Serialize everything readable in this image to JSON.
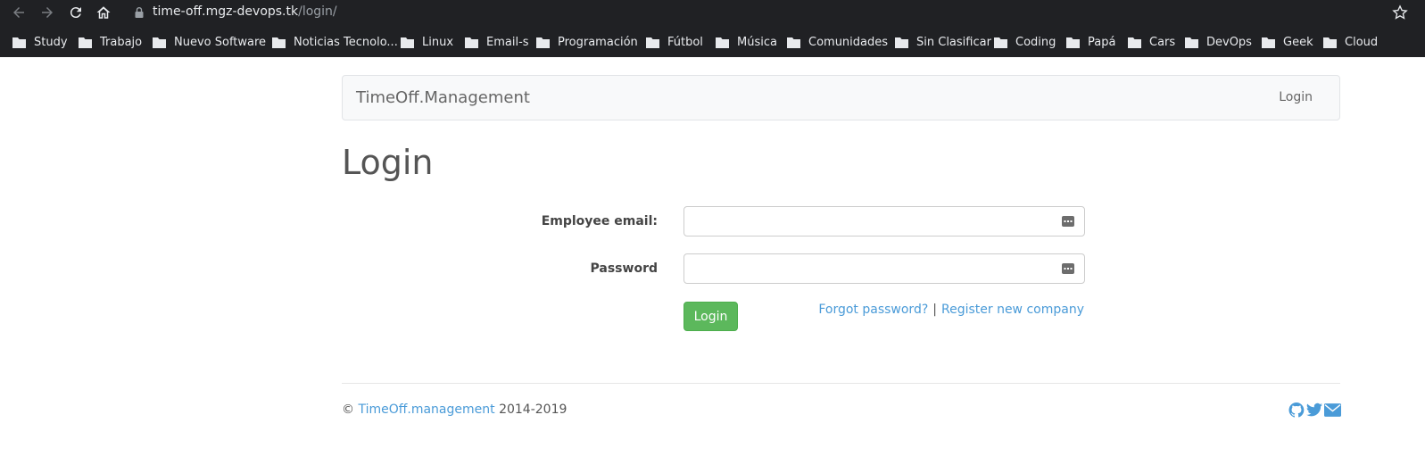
{
  "browser": {
    "url_host": "time-off.mgz-devops.tk",
    "url_path": "/login/",
    "bookmarks": [
      "Study",
      "Trabajo",
      "Nuevo Software",
      "Noticias Tecnolo...",
      "Linux",
      "Email-s",
      "Programación",
      "Fútbol",
      "Música",
      "Comunidades",
      "Sin Clasificar",
      "Coding",
      "Papá",
      "Cars",
      "DevOps",
      "Geek",
      "Cloud"
    ]
  },
  "navbar": {
    "brand": "TimeOff.Management",
    "login_link": "Login"
  },
  "page": {
    "title": "Login"
  },
  "form": {
    "email_label": "Employee email:",
    "email_value": "",
    "password_label": "Password",
    "password_value": "",
    "submit_label": "Login",
    "forgot_link": "Forgot password?",
    "separator": "|",
    "register_link": "Register new company"
  },
  "footer": {
    "copyright_symbol": "©",
    "site_link": "TimeOff.management",
    "years": "2014-2019",
    "social_icons": [
      "github-icon",
      "twitter-icon",
      "envelope-icon"
    ]
  },
  "colors": {
    "chrome_bg": "#202124",
    "link": "#4a9bd8",
    "button_success": "#5cb85c",
    "navbar_bg": "#f8f9fa"
  }
}
